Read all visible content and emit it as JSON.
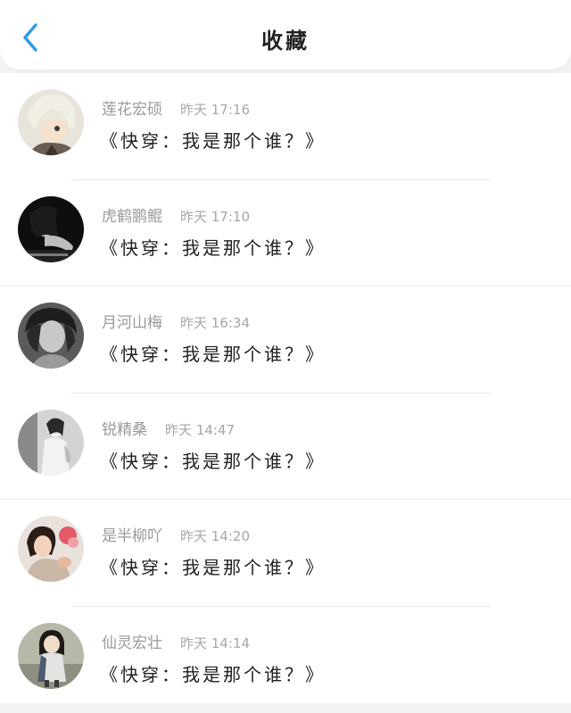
{
  "header": {
    "title": "收藏",
    "back_icon": "chevron-left-icon",
    "accent_color": "#2f9be6"
  },
  "items": [
    {
      "name": "莲花宏硕",
      "time": "昨天 17:16",
      "message": "《快穿：我是那个谁？》",
      "avatar": "anime-character-avatar"
    },
    {
      "name": "虎鹤鹏鲲",
      "time": "昨天 17:10",
      "message": "《快穿：我是那个谁？》",
      "avatar": "dark-portrait-avatar"
    },
    {
      "name": "月河山梅",
      "time": "昨天 16:34",
      "message": "《快穿：我是那个谁？》",
      "avatar": "bw-portrait-avatar"
    },
    {
      "name": "锐精桑",
      "time": "昨天 14:47",
      "message": "《快穿：我是那个谁？》",
      "avatar": "bw-photo-avatar"
    },
    {
      "name": "是半柳吖",
      "time": "昨天 14:20",
      "message": "《快穿：我是那个谁？》",
      "avatar": "child-photo-avatar"
    },
    {
      "name": "仙灵宏壮",
      "time": "昨天 14:14",
      "message": "《快穿：我是那个谁？》",
      "avatar": "girl-photo-avatar"
    }
  ]
}
